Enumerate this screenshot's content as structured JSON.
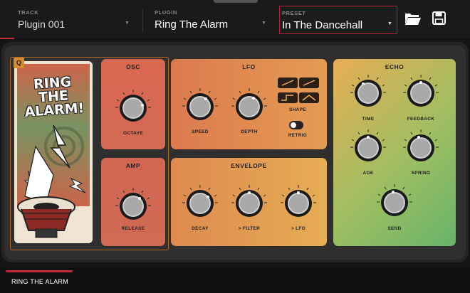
{
  "header": {
    "track_label": "TRACK",
    "track_value": "Plugin 001",
    "plugin_label": "PLUGIN",
    "plugin_value": "Ring The Alarm",
    "preset_label": "PRESET",
    "preset_value": "In The Dancehall",
    "folder_icon": "folder-open-icon",
    "save_icon": "save-icon"
  },
  "plugin_art": {
    "badge": "Q",
    "title": "RING THE ALARM!"
  },
  "sections": {
    "osc": {
      "title": "OSC",
      "octave": "OCTAVE"
    },
    "amp": {
      "title": "AMP",
      "release": "RELEASE"
    },
    "lfo": {
      "title": "LFO",
      "speed": "SPEED",
      "depth": "DEPTH",
      "shape": "SHAPE",
      "retrig": "RETRIG"
    },
    "envelope": {
      "title": "ENVELOPE",
      "decay": "DECAY",
      "filter": "> FILTER",
      "lfo": "> LFO"
    },
    "echo": {
      "title": "ECHO",
      "time": "TIME",
      "feedback": "FEEDBACK",
      "age": "AGE",
      "spring": "SPRING",
      "send": "SEND"
    }
  },
  "footer": {
    "tab_label": "RING THE ALARM"
  },
  "colors": {
    "accent": "#c42a3a",
    "osc": "#d86a50",
    "amp": "#cf6753",
    "lfo": "#de8a50",
    "envelope": "#e4a250",
    "echo": "#9fbd62"
  }
}
